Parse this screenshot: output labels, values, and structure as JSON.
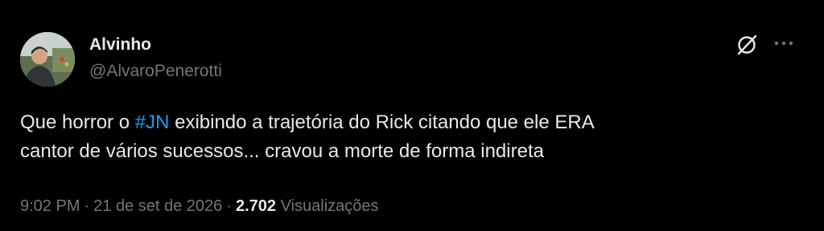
{
  "author": {
    "display_name": "Alvinho",
    "handle": "@AlvaroPenerotti"
  },
  "actions": {
    "grok_icon": "grok-slash-icon",
    "more_icon": "more-horizontal-icon"
  },
  "body": {
    "before_hashtag": "Que horror o ",
    "hashtag": "#JN",
    "line1_rest": " exibindo a trajetória do Rick citando que ele ERA",
    "line2": "cantor de vários sucessos... cravou a morte de forma indireta"
  },
  "meta": {
    "time": "9:02 PM",
    "separator": "·",
    "date": "21 de set de 2026",
    "views_count": "2.702",
    "views_label": "Visualizações"
  },
  "colors": {
    "background": "#000000",
    "text": "#e7e9ea",
    "secondary": "#71767b",
    "accent": "#1d9bf0"
  }
}
